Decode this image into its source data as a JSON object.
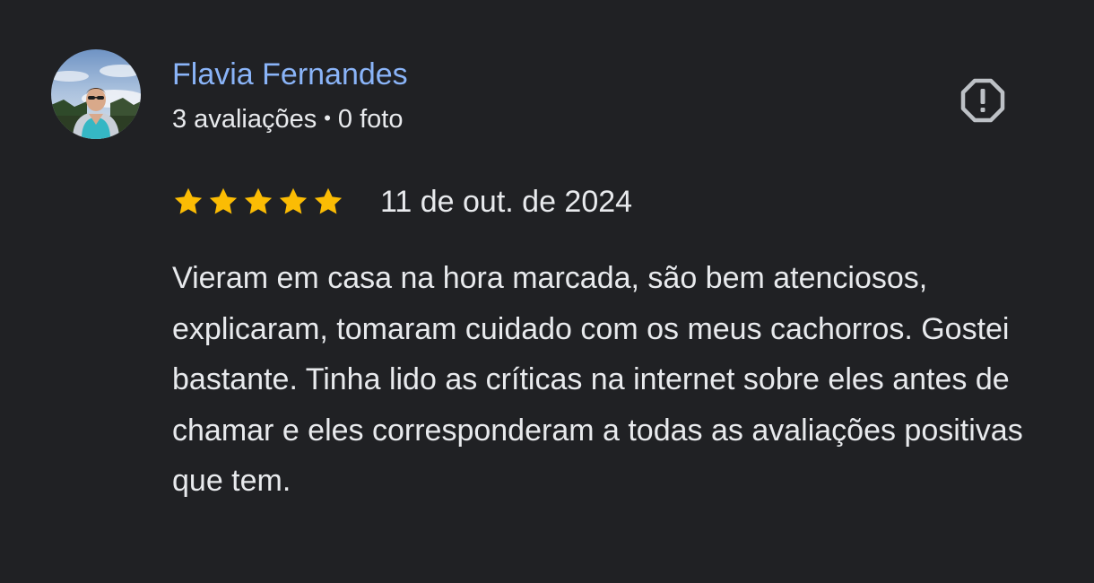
{
  "review": {
    "author": {
      "name": "Flavia Fernandes",
      "reviews_count": "3 avaliações",
      "separator": "•",
      "photos_count": "0 foto"
    },
    "rating": {
      "stars": 5,
      "max": 5,
      "star_color": "#fbbc04"
    },
    "date": "11 de out. de 2024",
    "text": "Vieram em casa na hora marcada, são bem atenciosos, explicaram, tomaram cuidado com os meus cachorros. Gostei bastante. Tinha lido as críticas na internet sobre eles antes de chamar e eles corresponderam a todas as avaliações positivas que tem.",
    "report_icon": "report-flag-icon"
  },
  "colors": {
    "background": "#202124",
    "author_link": "#8ab4f8",
    "text": "#e8eaed",
    "icon": "#bdc1c6"
  }
}
